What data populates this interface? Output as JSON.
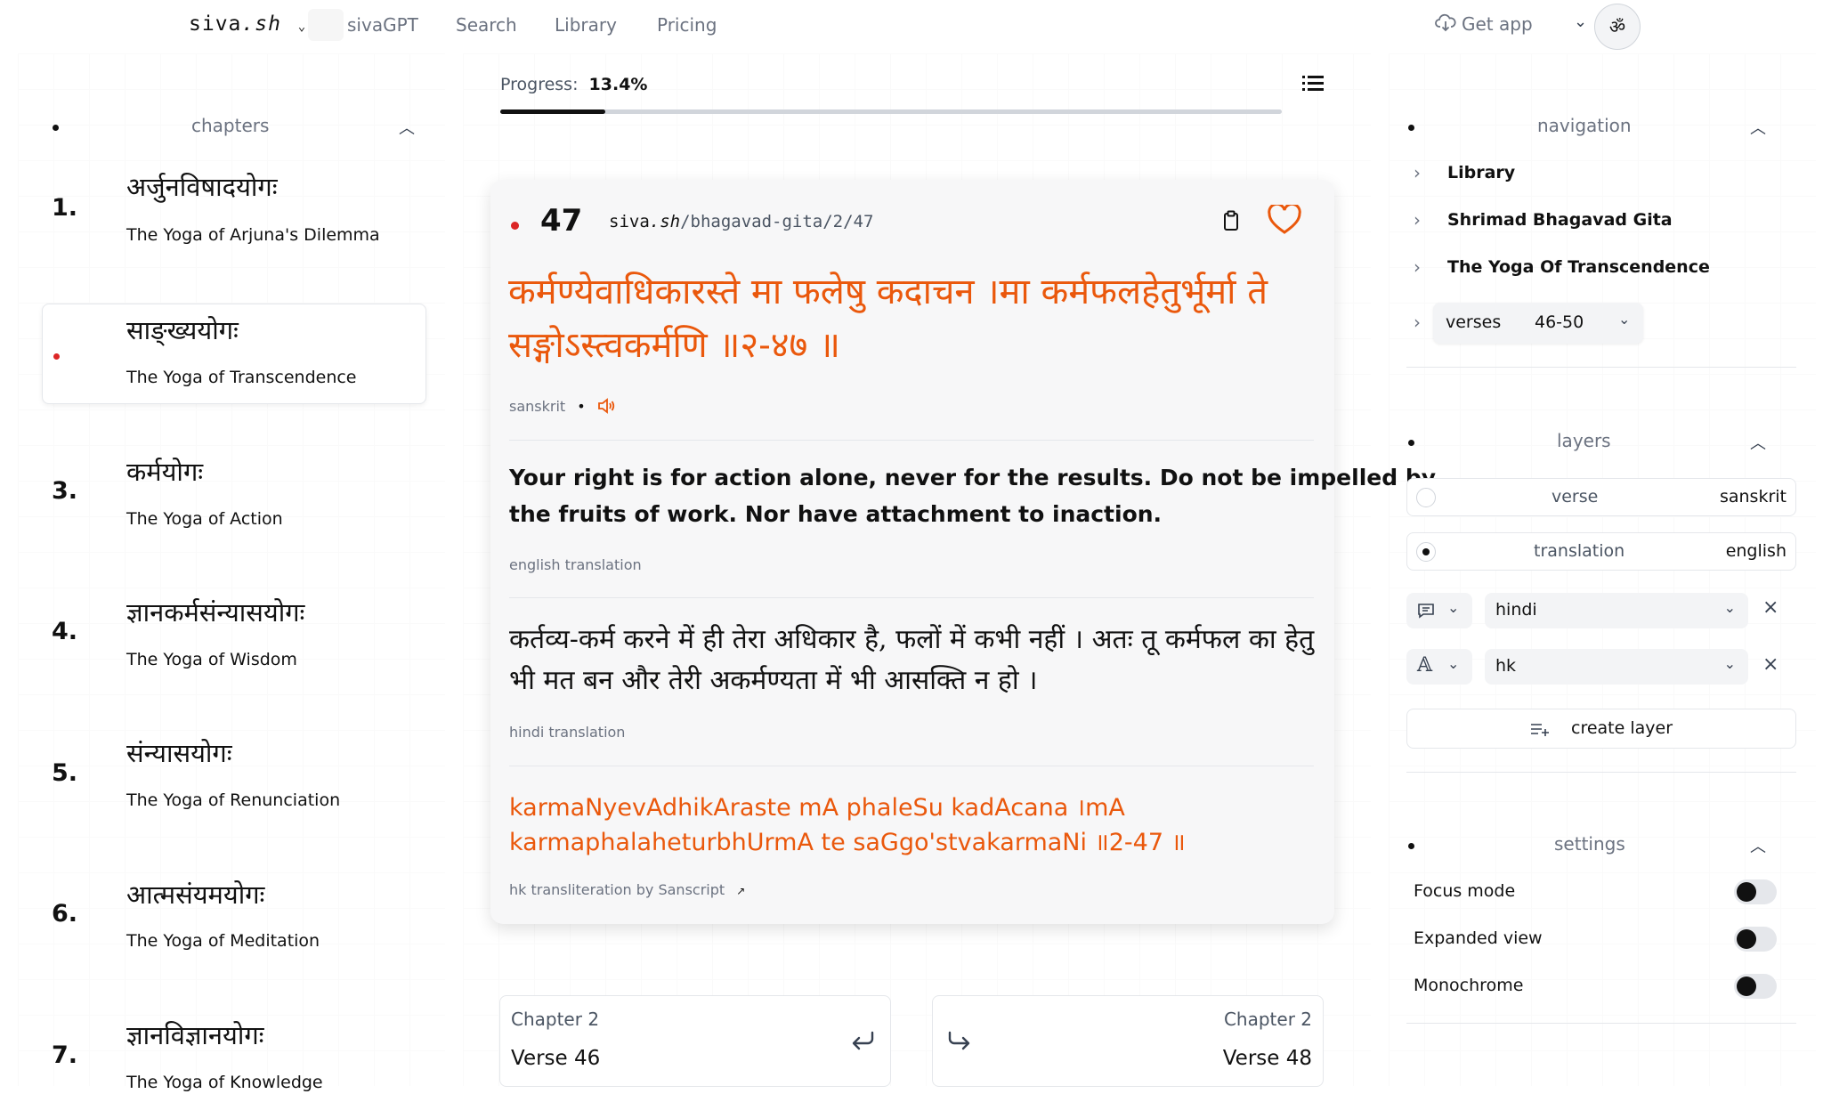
{
  "header": {
    "logo_main": "siva",
    "logo_ext": ".sh",
    "nav": [
      "sivaGPT",
      "Search",
      "Library",
      "Pricing"
    ],
    "get_app": "Get app",
    "avatar_glyph": "ॐ"
  },
  "progress": {
    "label": "Progress:",
    "value_text": "13.4%",
    "fraction": 0.134
  },
  "chapters": {
    "title": "chapters",
    "items": [
      {
        "number": "1.",
        "devanagari": "अर्जुनविषादयोगः",
        "english": "The Yoga of Arjuna's Dilemma"
      },
      {
        "number": "",
        "devanagari": "साङ्ख्ययोगः",
        "english": "The Yoga of Transcendence"
      },
      {
        "number": "3.",
        "devanagari": "कर्मयोगः",
        "english": "The Yoga of Action"
      },
      {
        "number": "4.",
        "devanagari": "ज्ञानकर्मसंन्यासयोगः",
        "english": "The Yoga of Wisdom"
      },
      {
        "number": "5.",
        "devanagari": "संन्यासयोगः",
        "english": "The Yoga of Renunciation"
      },
      {
        "number": "6.",
        "devanagari": "आत्मसंयमयोगः",
        "english": "The Yoga of Meditation"
      },
      {
        "number": "7.",
        "devanagari": "ज्ञानविज्ञानयोगः",
        "english": "The Yoga of Knowledge"
      }
    ]
  },
  "verse": {
    "number": "47",
    "url_prefix": "siva",
    "url_ext": ".sh",
    "url_path": "/bhagavad-gita/2/47",
    "sanskrit_line1": "कर्मण्येवाधिकारस्ते मा फलेषु कदाचन ।मा कर्मफलहेतुर्भूर्मा ते",
    "sanskrit_line2": "सङ्गोऽस्त्वकर्मणि ॥२-४७ ॥",
    "sanskrit_label": "sanskrit",
    "english_line1": "Your right is for action alone, never for the results. Do not be impelled by",
    "english_line2": "the fruits of work. Nor have attachment to inaction.",
    "english_label": "english translation",
    "hindi_line1": "कर्तव्य-कर्म करने में ही तेरा अधिकार है, फलों में कभी नहीं । अतः तू कर्मफल का हेतु",
    "hindi_line2": "भी मत बन और तेरी अकर्मण्यता में भी आसक्ति न हो ।",
    "hindi_label": "hindi translation",
    "hk_line1": "karmaNyevAdhikAraste mA phaleSu kadAcana ।mA",
    "hk_line2": "karmaphalaheturbhUrmA te saGgo'stvakarmaNi ॥2-47 ॥",
    "hk_label": "hk transliteration by Sanscript",
    "hk_link_glyph": "↗"
  },
  "pager": {
    "prev": {
      "chapter": "Chapter 2",
      "verse": "Verse 46"
    },
    "next": {
      "chapter": "Chapter 2",
      "verse": "Verse 48"
    }
  },
  "navigation": {
    "title": "navigation",
    "items": [
      "Library",
      "Shrimad Bhagavad Gita",
      "The Yoga Of Transcendence"
    ],
    "verses_label": "verses",
    "verses_range": "46-50"
  },
  "layers": {
    "title": "layers",
    "rows": [
      {
        "label": "verse",
        "value": "sanskrit"
      },
      {
        "label": "translation",
        "value": "english"
      }
    ],
    "select_hindi": "hindi",
    "select_hk": "hk",
    "create": "create layer"
  },
  "settings": {
    "title": "settings",
    "items": [
      "Focus mode",
      "Expanded view",
      "Monochrome"
    ]
  },
  "colors": {
    "accent": "#ea580c",
    "active_dot": "#dc2626"
  }
}
